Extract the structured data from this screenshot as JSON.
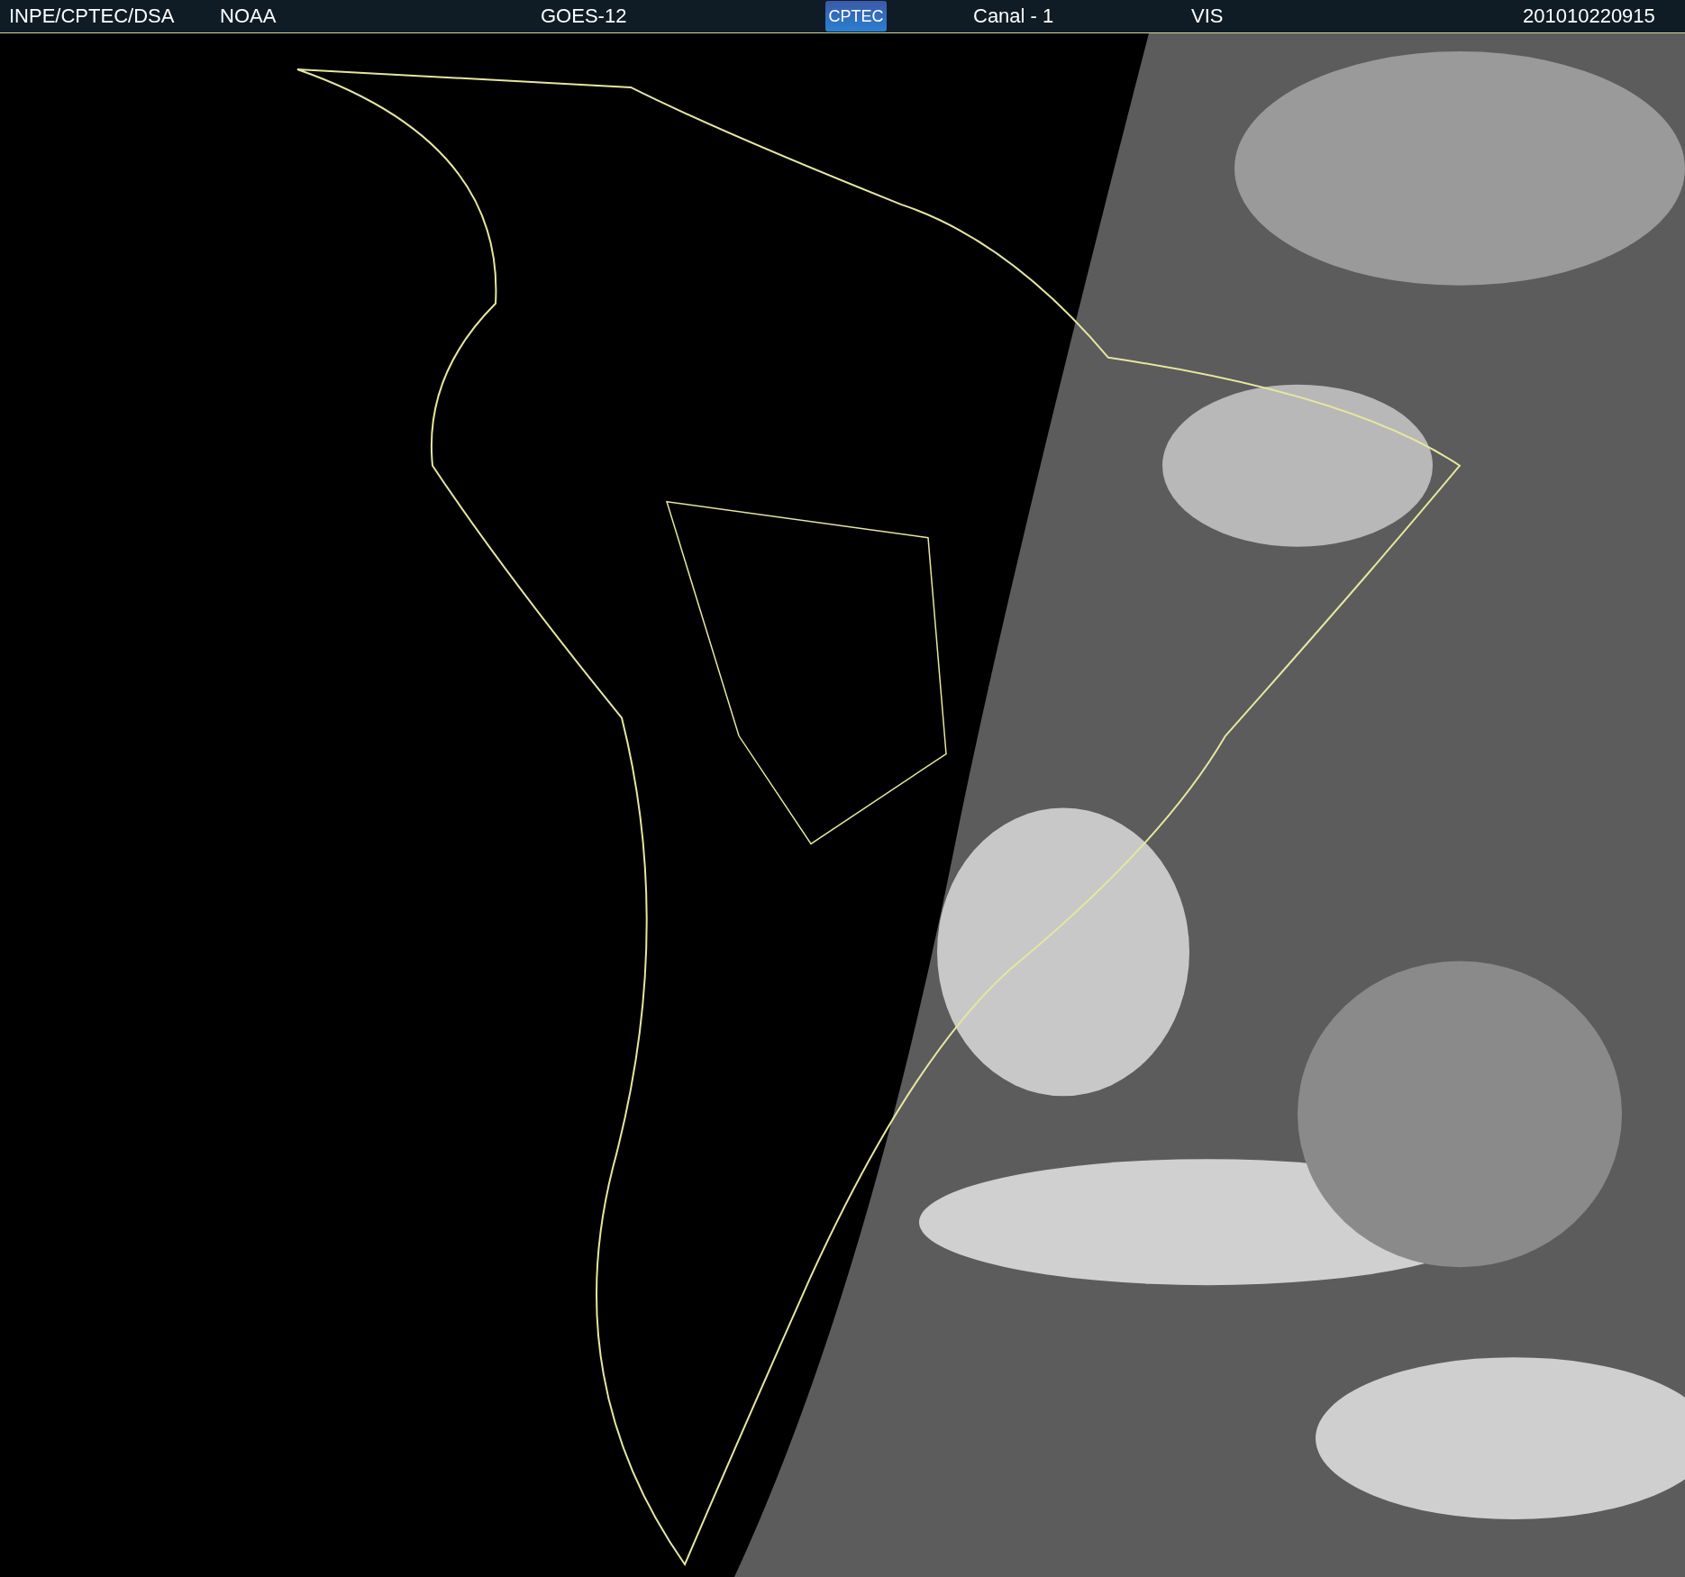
{
  "header": {
    "labels": [
      "INPE/CPTEC/DSA",
      "NOAA",
      "GOES-12"
    ],
    "logo": "CPTEC",
    "channel": "Canal - 1",
    "band": "VIS",
    "timestamp": "201010220915"
  }
}
